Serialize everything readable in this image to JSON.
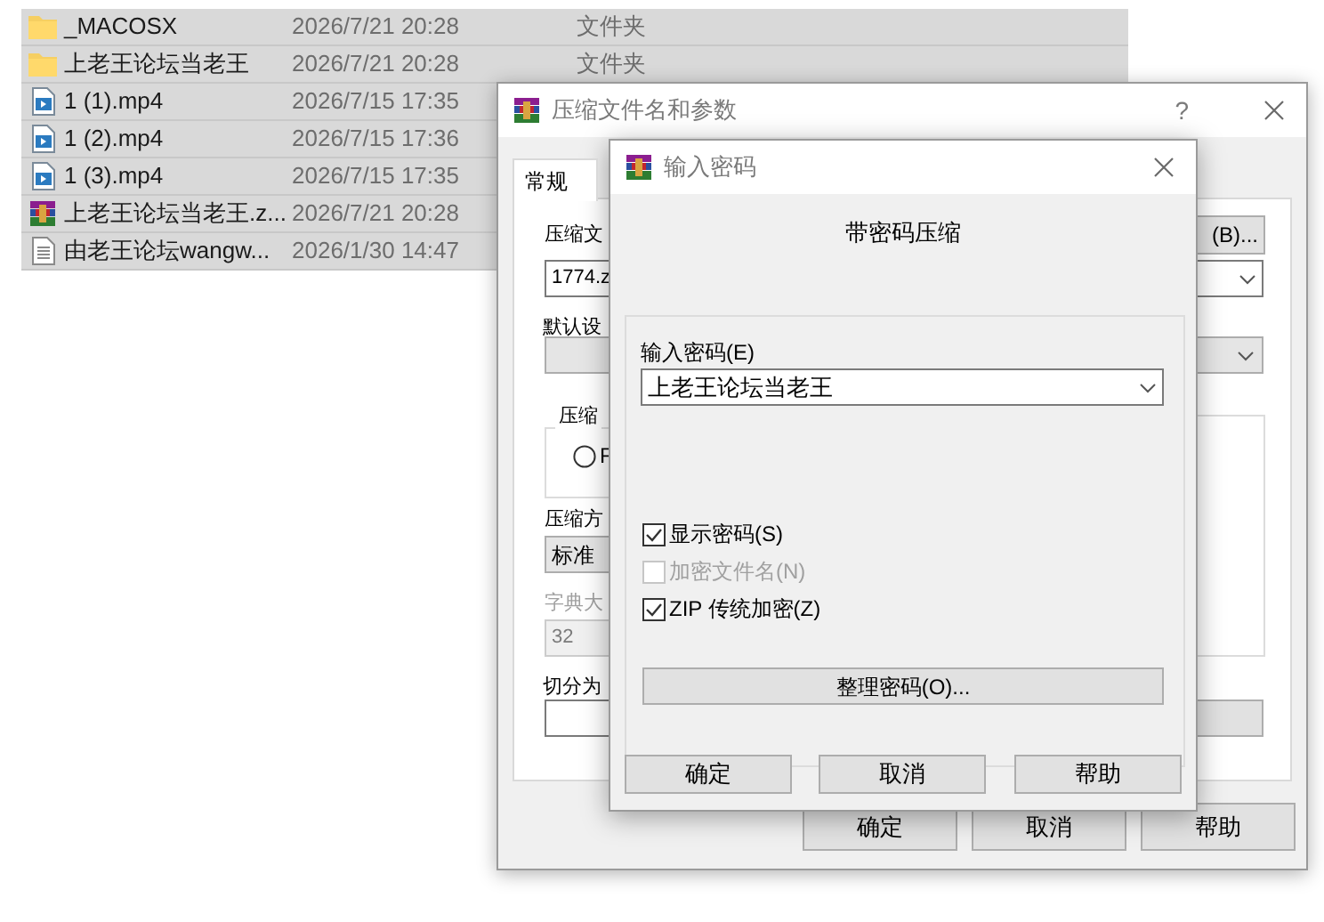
{
  "file_list": {
    "rows": [
      {
        "kind": "folder",
        "name": "_MACOSX",
        "date": "2026/7/21 20:28",
        "type": "文件夹",
        "selected": true
      },
      {
        "kind": "folder",
        "name": "上老王论坛当老王",
        "date": "2026/7/21 20:28",
        "type": "文件夹",
        "selected": true
      },
      {
        "kind": "video",
        "name": "1 (1).mp4",
        "date": "2026/7/15 17:35",
        "selected": true
      },
      {
        "kind": "video",
        "name": "1 (2).mp4",
        "date": "2026/7/15 17:36",
        "selected": true
      },
      {
        "kind": "video",
        "name": "1 (3).mp4",
        "date": "2026/7/15 17:35",
        "selected": true
      },
      {
        "kind": "archive",
        "name": "上老王论坛当老王.z...",
        "date": "2026/7/21 20:28",
        "selected": true
      },
      {
        "kind": "text",
        "name": "由老王论坛wangw...",
        "date": "2026/1/30 14:47",
        "selected": true
      }
    ]
  },
  "archive_dialog": {
    "title": "压缩文件名和参数",
    "help": "?",
    "tabs": [
      {
        "label": "常规",
        "selected": true
      }
    ],
    "archive_name_label": "压缩文",
    "browse_button": "(B)...",
    "archive_name": "1774.z",
    "profile_label": "默认设",
    "format_group": "压缩",
    "format_option": {
      "label": "F",
      "selected": false
    },
    "method_label": "压缩方",
    "method": "标准",
    "dictionary": {
      "label": "字典大",
      "value": "32",
      "disabled": true
    },
    "split_label": "切分为",
    "buttons": [
      "确定",
      "取消",
      "帮助"
    ]
  },
  "password_dialog": {
    "title": "输入密码",
    "heading": "带密码压缩",
    "password_label": "输入密码(E)",
    "password": "上老王论坛当老王",
    "options": [
      {
        "label": "显示密码(S)",
        "checked": true,
        "disabled": false
      },
      {
        "label": "加密文件名(N)",
        "checked": false,
        "disabled": true
      },
      {
        "label": "ZIP 传统加密(Z)",
        "checked": true,
        "disabled": false
      }
    ],
    "organize_button": "整理密码(O)...",
    "buttons": [
      "确定",
      "取消",
      "帮助"
    ]
  }
}
